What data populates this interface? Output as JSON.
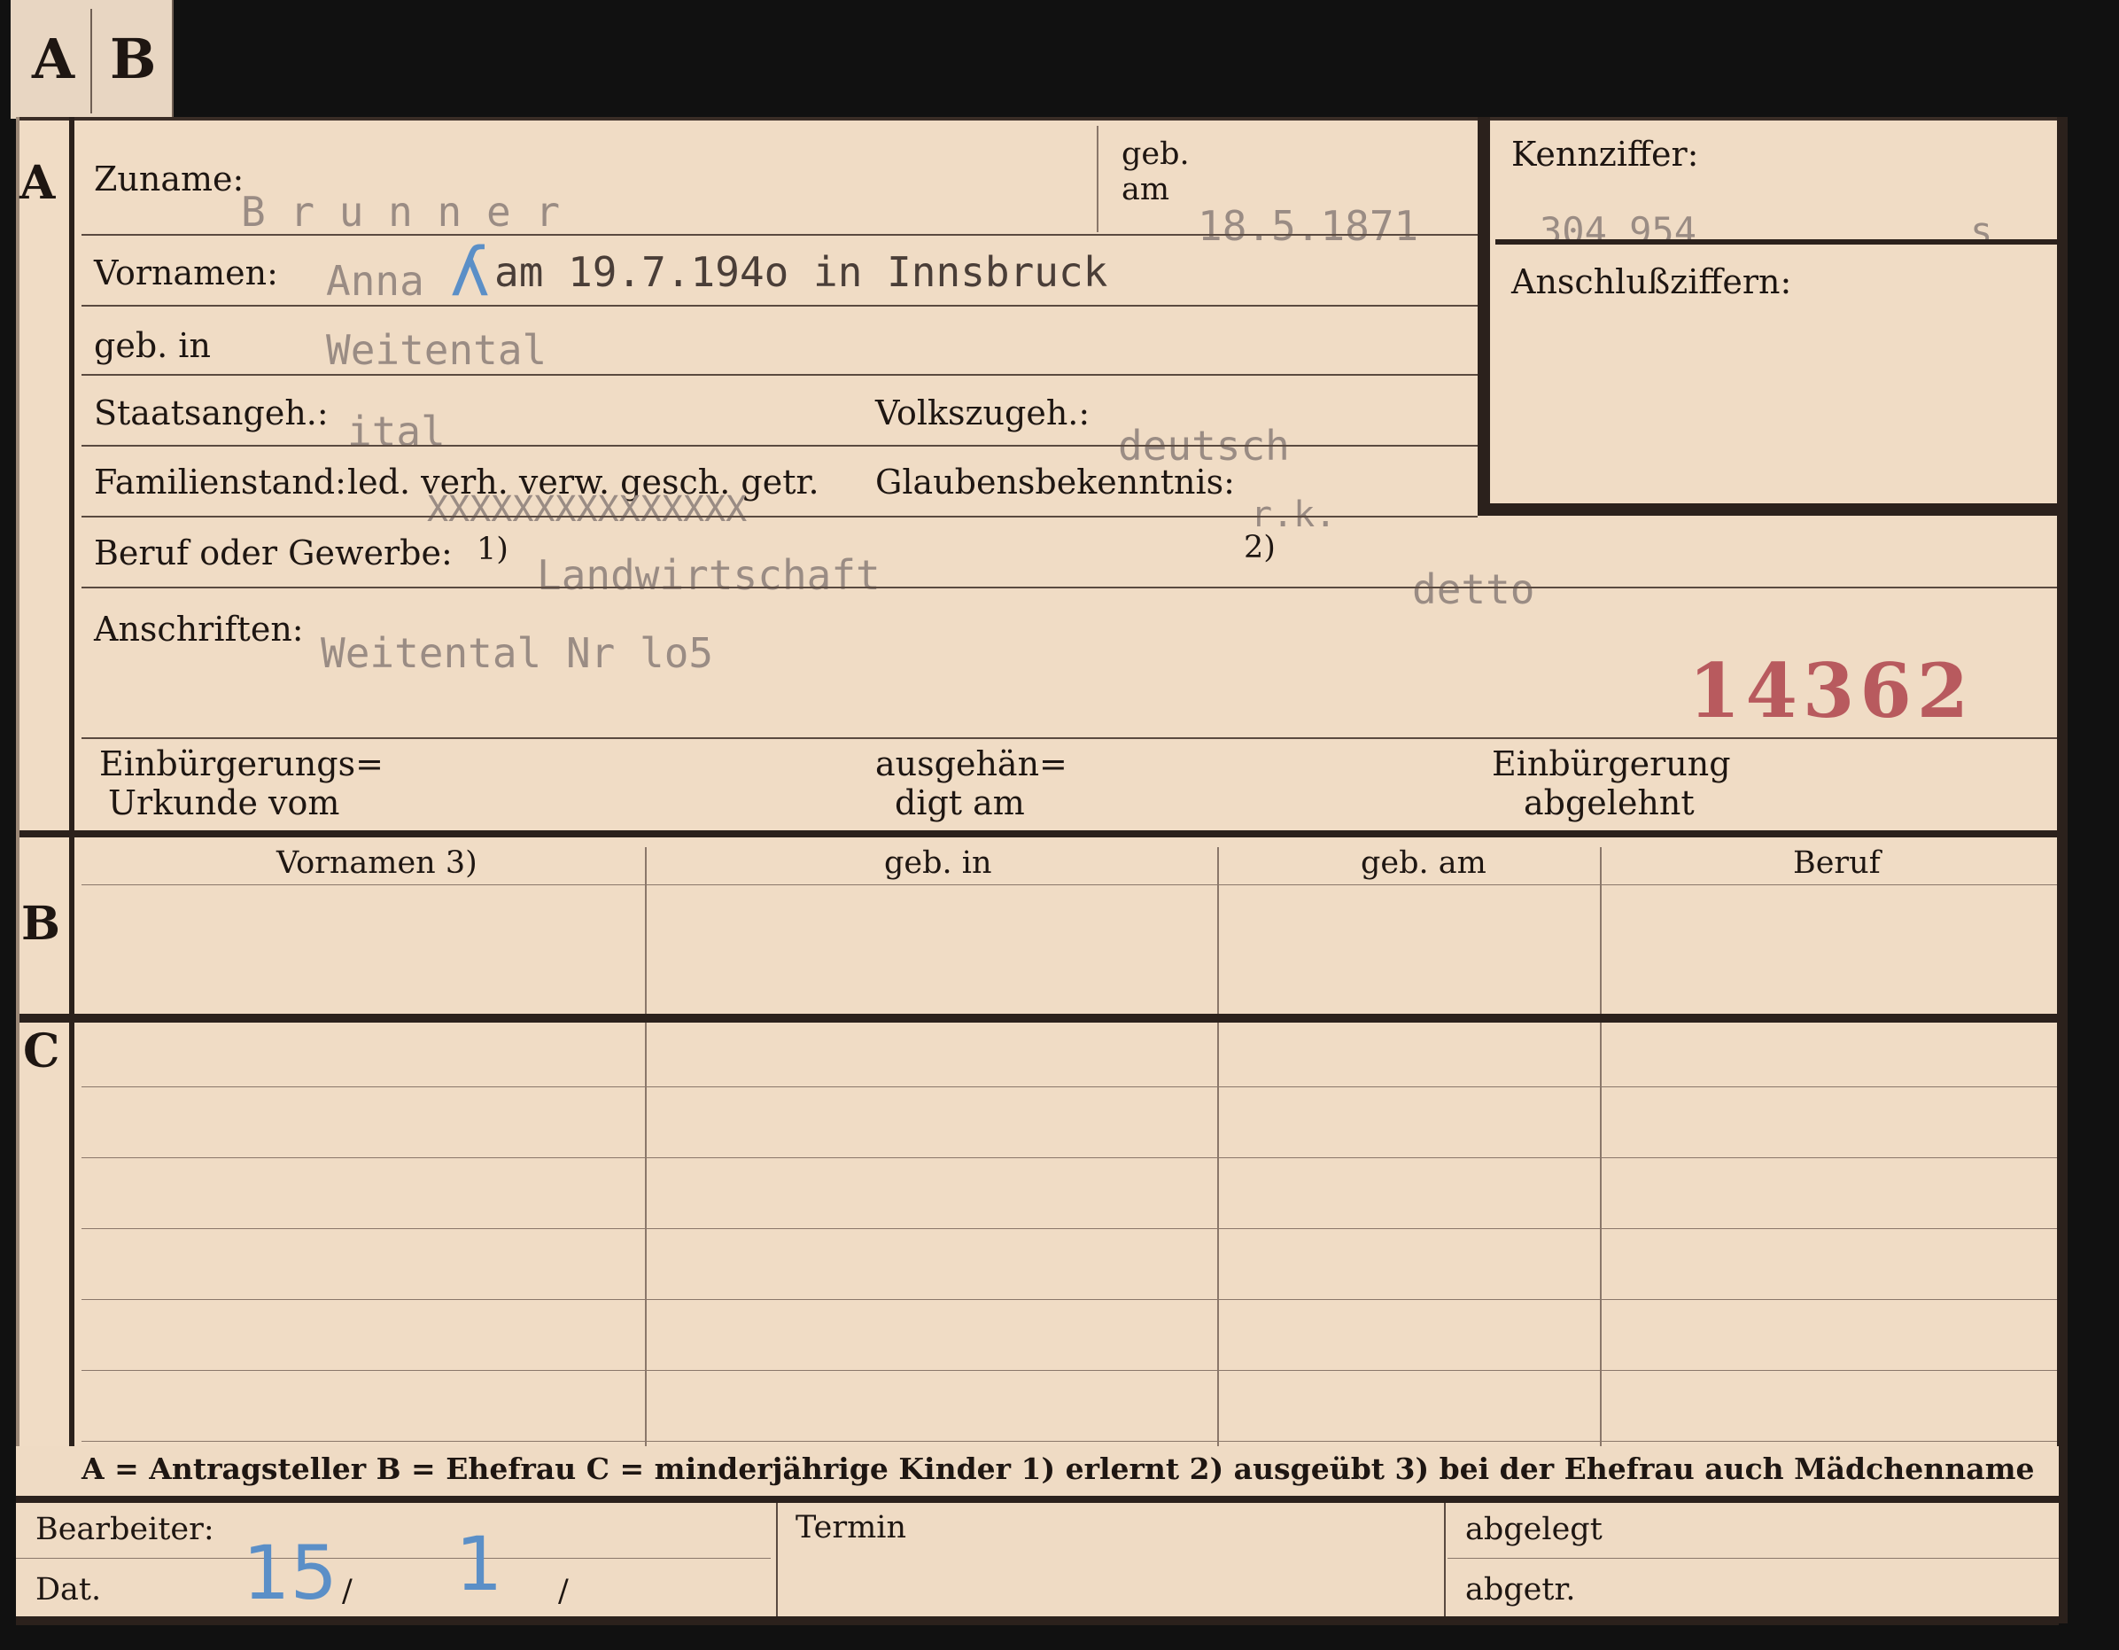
{
  "tab": {
    "a": "A",
    "b": "B"
  },
  "sections": {
    "a": "A",
    "b": "B",
    "c": "C"
  },
  "labels": {
    "zuname": "Zuname:",
    "geb": "geb.",
    "am": "am",
    "kennziffer": "Kennziffer:",
    "anschluss": "Anschlußziffern:",
    "vornamen": "Vornamen:",
    "gebin": "geb. in",
    "staats": "Staatsangeh.:",
    "volks": "Volkszugeh.:",
    "familien": "Familienstand:",
    "familien_opts": "led. verh. verw. gesch. getr.",
    "glauben": "Glaubensbekenntnis:",
    "beruf": "Beruf oder Gewerbe:",
    "note1": "1)",
    "note2": "2)",
    "anschriften": "Anschriften:",
    "einb1": "Einbürgerungs=",
    "einb2": "Urkunde vom",
    "ausg1": "ausgehän=",
    "ausg2": "digt am",
    "abg1": "Einbürgerung",
    "abg2": "abgelehnt"
  },
  "values": {
    "zuname": "B r u n n e r",
    "geb_am": "18.5.1871",
    "kennziffer": "304 954",
    "kennziffer_suffix": "s",
    "vornamen": "Anna",
    "vornamen_note": "am 19.7.194o in Innsbruck",
    "gebin": "Weitental",
    "staats": "ital",
    "volks": "deutsch",
    "familien_mark": "XXXXXXXXXXXXXXX",
    "glauben": "r.k.",
    "beruf1": "Landwirtschaft",
    "beruf2": "detto",
    "anschrift": "Weitental Nr lo5",
    "stamp": "14362"
  },
  "table": {
    "headers": [
      "Vornamen 3)",
      "geb. in",
      "geb. am",
      "Beruf"
    ]
  },
  "legend": "A = Antragsteller   B = Ehefrau   C = minderjährige Kinder   1) erlernt   2) ausgeübt   3) bei der Ehefrau auch Mädchenname",
  "footer": {
    "bearbeiter": "Bearbeiter:",
    "dat": "Dat.",
    "termin": "Termin",
    "abgelegt": "abgelegt",
    "abgetr": "abgetr.",
    "date_day": "15",
    "date_sep1": "/",
    "date_month": "1",
    "date_sep2": "/"
  }
}
